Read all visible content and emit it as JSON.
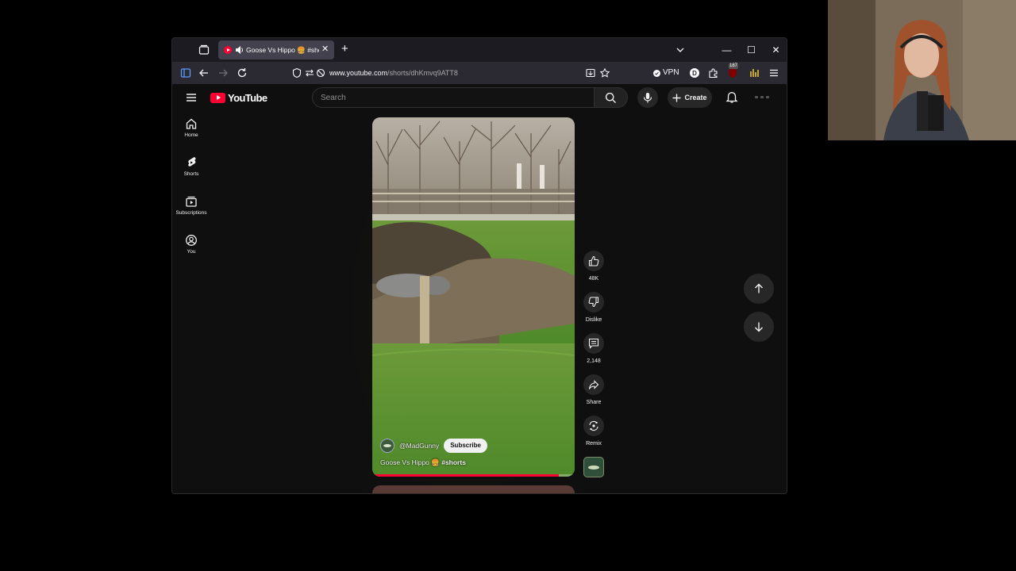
{
  "browser": {
    "tab_title": "Goose Vs Hippo 🍔 #shorts",
    "tab_close": "✕",
    "new_tab": "+",
    "url_host": "www.youtube.com",
    "url_path": "/shorts/dhKmvq9ATT8",
    "vpn_label": "VPN",
    "extension_badge": "187",
    "window_controls": {
      "minimize": "—",
      "maximize": "☐",
      "close": "✕"
    }
  },
  "youtube": {
    "logo_text": "YouTube",
    "search_placeholder": "Search",
    "create_label": "Create",
    "guide": [
      {
        "label": "Home",
        "icon": "home-icon"
      },
      {
        "label": "Shorts",
        "icon": "shorts-icon"
      },
      {
        "label": "Subscriptions",
        "icon": "subscriptions-icon"
      },
      {
        "label": "You",
        "icon": "account-icon"
      }
    ],
    "short": {
      "channel_handle": "@MadGunny",
      "subscribe_label": "Subscribe",
      "title": "Goose Vs Hippo 🍔",
      "hashtag": "#shorts",
      "progress_fraction": 0.92
    },
    "actions": {
      "likes": "48K",
      "dislike": "Dislike",
      "comments": "2,148",
      "share": "Share",
      "remix": "Remix"
    }
  },
  "colors": {
    "yt_red": "#ff0033",
    "background": "#0f0f0f",
    "chip": "#272727",
    "firefox_toolbar": "#2b2a33"
  }
}
